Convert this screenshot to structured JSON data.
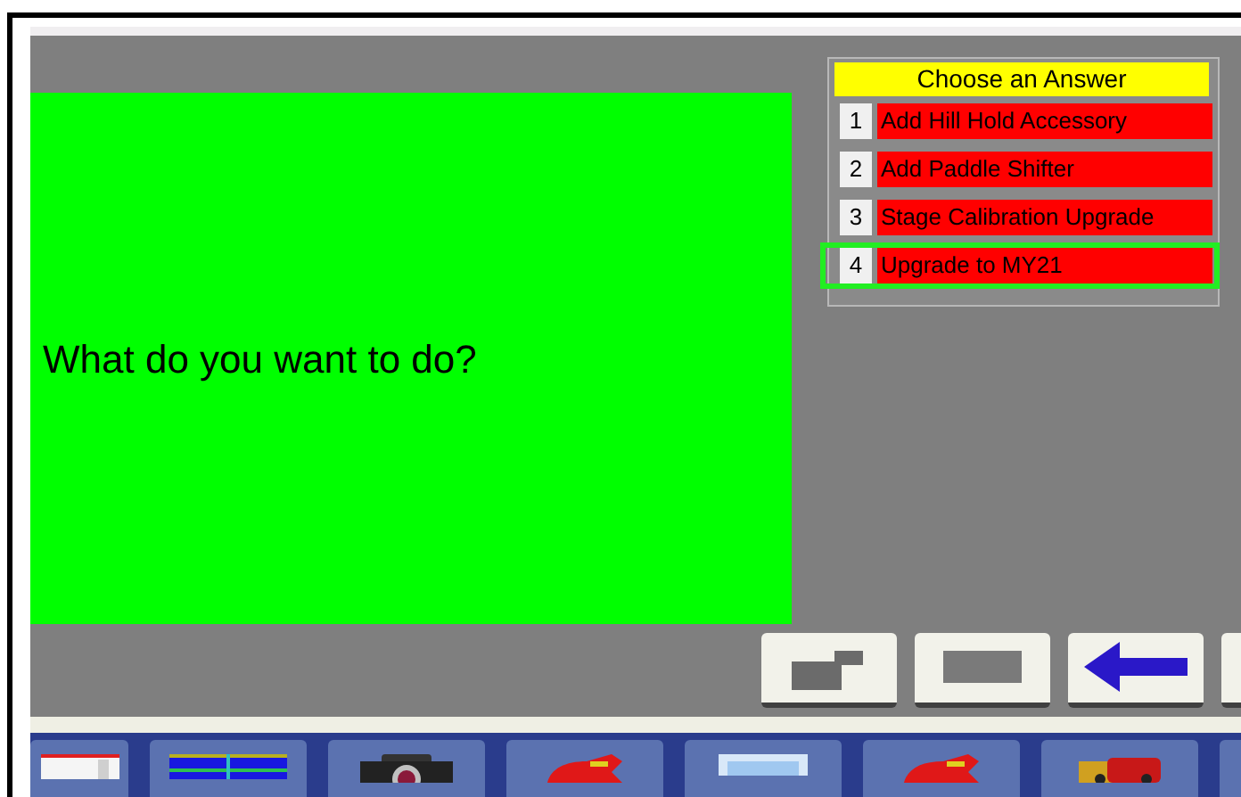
{
  "question": {
    "text": "What do you want to do?"
  },
  "answers": {
    "title": "Choose an Answer",
    "items": [
      {
        "number": "1",
        "label": "Add Hill Hold Accessory",
        "selected": false
      },
      {
        "number": "2",
        "label": "Add Paddle Shifter",
        "selected": false
      },
      {
        "number": "3",
        "label": "Stage Calibration Upgrade",
        "selected": false
      },
      {
        "number": "4",
        "label": "Upgrade to MY21",
        "selected": true
      }
    ]
  },
  "toolbar": [
    {
      "kind": "folder"
    },
    {
      "kind": "blank"
    },
    {
      "kind": "back"
    },
    {
      "kind": "edge"
    }
  ],
  "taskbar": [
    {
      "kind": "document"
    },
    {
      "kind": "table"
    },
    {
      "kind": "camera"
    },
    {
      "kind": "vehicle"
    },
    {
      "kind": "screen"
    },
    {
      "kind": "vehicle"
    },
    {
      "kind": "vehicles"
    },
    {
      "kind": "edge"
    }
  ]
}
